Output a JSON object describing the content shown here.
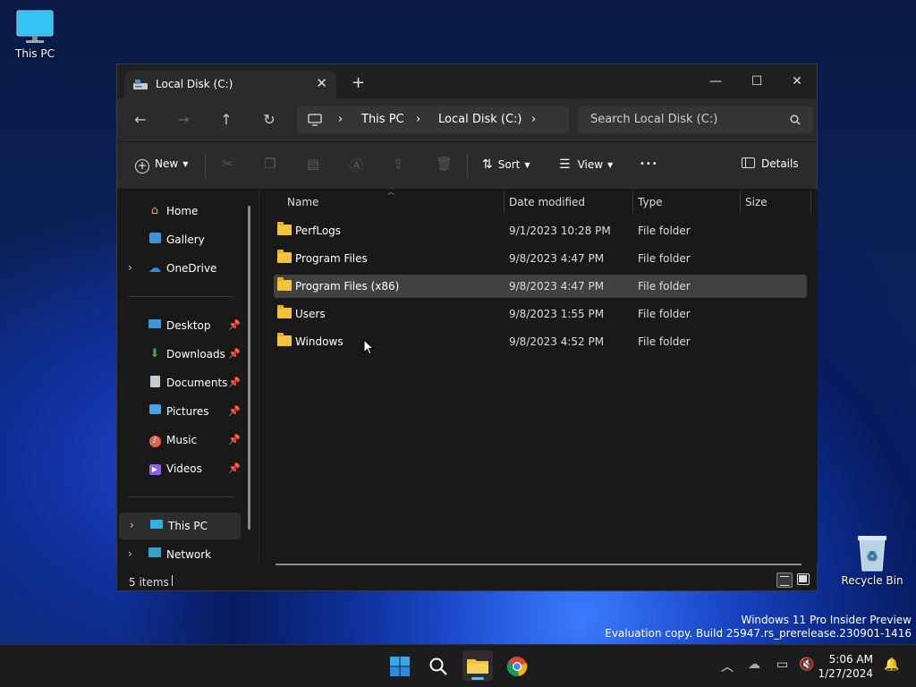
{
  "desktop": {
    "this_pc_label": "This PC",
    "recycle_bin_label": "Recycle Bin",
    "watermark_line1": "Windows 11 Pro Insider Preview",
    "watermark_line2": "Evaluation copy. Build 25947.rs_prerelease.230901-1416"
  },
  "window": {
    "tab_title": "Local Disk (C:)",
    "tab_close": "✕",
    "new_tab": "+",
    "minimize": "—",
    "maximize": "☐",
    "close": "✕"
  },
  "nav": {
    "back": "←",
    "forward": "→",
    "up": "↑",
    "refresh": "↻",
    "breadcrumb": [
      "This PC",
      "Local Disk (C:)"
    ],
    "separator": "›",
    "search_placeholder": "Search Local Disk (C:)"
  },
  "toolbar": {
    "new_label": "New",
    "sort_label": "Sort",
    "view_label": "View",
    "more_label": "•••",
    "details_label": "Details"
  },
  "sidebar": {
    "items": [
      {
        "label": "Home",
        "icon": "home-icon"
      },
      {
        "label": "Gallery",
        "icon": "gallery-icon"
      },
      {
        "label": "OneDrive",
        "icon": "cloud-icon"
      },
      {
        "label": "Desktop",
        "icon": "desktop-icon"
      },
      {
        "label": "Downloads",
        "icon": "download-icon"
      },
      {
        "label": "Documents",
        "icon": "documents-icon"
      },
      {
        "label": "Pictures",
        "icon": "pictures-icon"
      },
      {
        "label": "Music",
        "icon": "music-icon"
      },
      {
        "label": "Videos",
        "icon": "videos-icon"
      },
      {
        "label": "This PC",
        "icon": "computer-icon"
      },
      {
        "label": "Network",
        "icon": "network-icon"
      }
    ]
  },
  "table": {
    "columns": [
      "Name",
      "Date modified",
      "Type",
      "Size"
    ],
    "rows": [
      {
        "name": "PerfLogs",
        "date": "9/1/2023 10:28 PM",
        "type": "File folder"
      },
      {
        "name": "Program Files",
        "date": "9/8/2023 4:47 PM",
        "type": "File folder"
      },
      {
        "name": "Program Files (x86)",
        "date": "9/8/2023 4:47 PM",
        "type": "File folder"
      },
      {
        "name": "Users",
        "date": "9/8/2023 1:55 PM",
        "type": "File folder"
      },
      {
        "name": "Windows",
        "date": "9/8/2023 4:52 PM",
        "type": "File folder"
      }
    ]
  },
  "status": {
    "items_count": "5 items"
  },
  "taskbar": {
    "time": "5:06 AM",
    "date": "1/27/2024"
  },
  "colors": {
    "folder": "#f3c33c",
    "accent": "#0078d4",
    "selected_row": "#414141"
  }
}
